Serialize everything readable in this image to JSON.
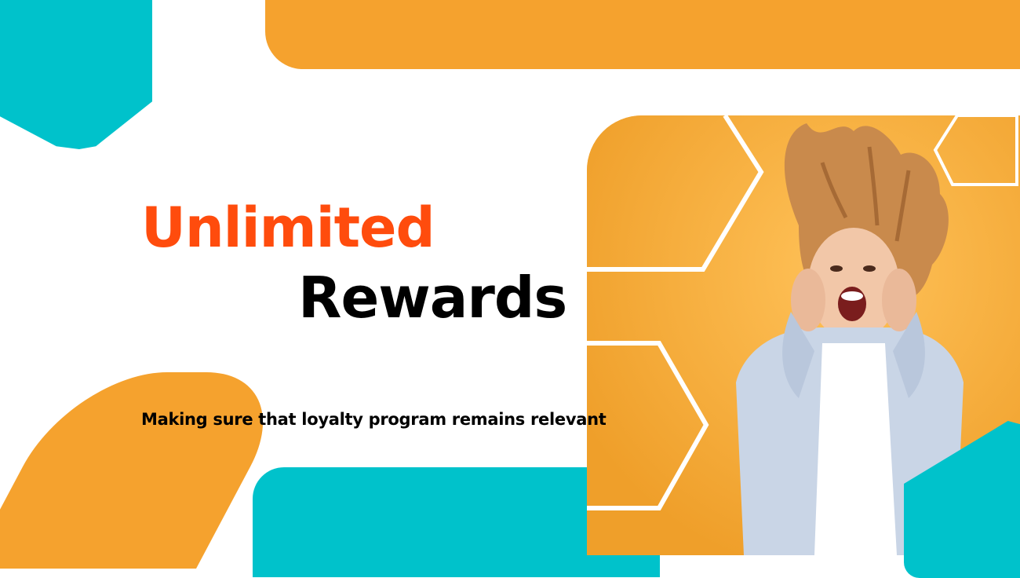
{
  "colors": {
    "teal": "#00c2cb",
    "orange": "#f5a22e",
    "headline_accent": "#ff4c0d",
    "panel_bg": "#f2a531"
  },
  "banner": {
    "headline_line1": "Unlimited",
    "headline_line2": "Rewards",
    "tagline": "Making sure that loyalty program remains relevant"
  },
  "photo": {
    "subject": "excited-woman-photo"
  }
}
